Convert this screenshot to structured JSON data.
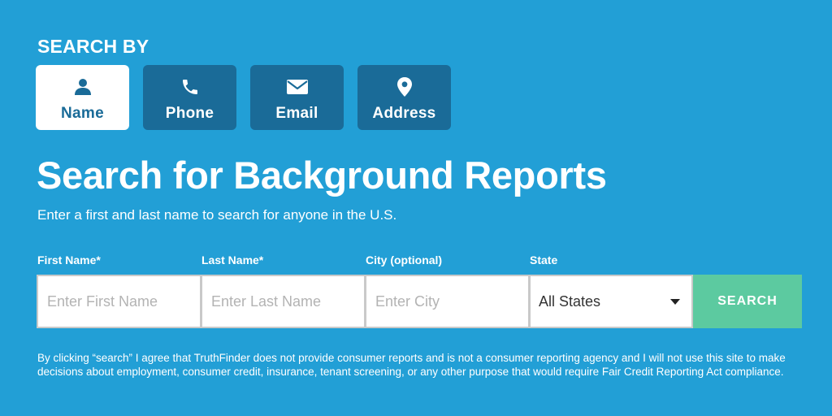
{
  "search_by_label": "SEARCH BY",
  "tabs": [
    {
      "label": "Name",
      "icon": "person-icon",
      "active": true
    },
    {
      "label": "Phone",
      "icon": "phone-icon",
      "active": false
    },
    {
      "label": "Email",
      "icon": "envelope-icon",
      "active": false
    },
    {
      "label": "Address",
      "icon": "map-pin-icon",
      "active": false
    }
  ],
  "title": "Search for Background Reports",
  "subtitle": "Enter a first and last name to search for anyone in the U.S.",
  "form": {
    "first_name": {
      "label": "First Name*",
      "placeholder": "Enter First Name",
      "value": ""
    },
    "last_name": {
      "label": "Last Name*",
      "placeholder": "Enter Last Name",
      "value": ""
    },
    "city": {
      "label": "City (optional)",
      "placeholder": "Enter City",
      "value": ""
    },
    "state": {
      "label": "State",
      "selected": "All States"
    },
    "search_button": "SEARCH"
  },
  "disclaimer": "By clicking “search” I agree that TruthFinder does not provide consumer reports and is not a consumer reporting agency and I will not use this site to make decisions about employment, consumer credit, insurance, tenant screening, or any other purpose that would require Fair Credit Reporting Act compliance.",
  "colors": {
    "background": "#229fd6",
    "tab_inactive": "#1a6b98",
    "tab_active": "#ffffff",
    "search_button": "#5ccaa0"
  }
}
